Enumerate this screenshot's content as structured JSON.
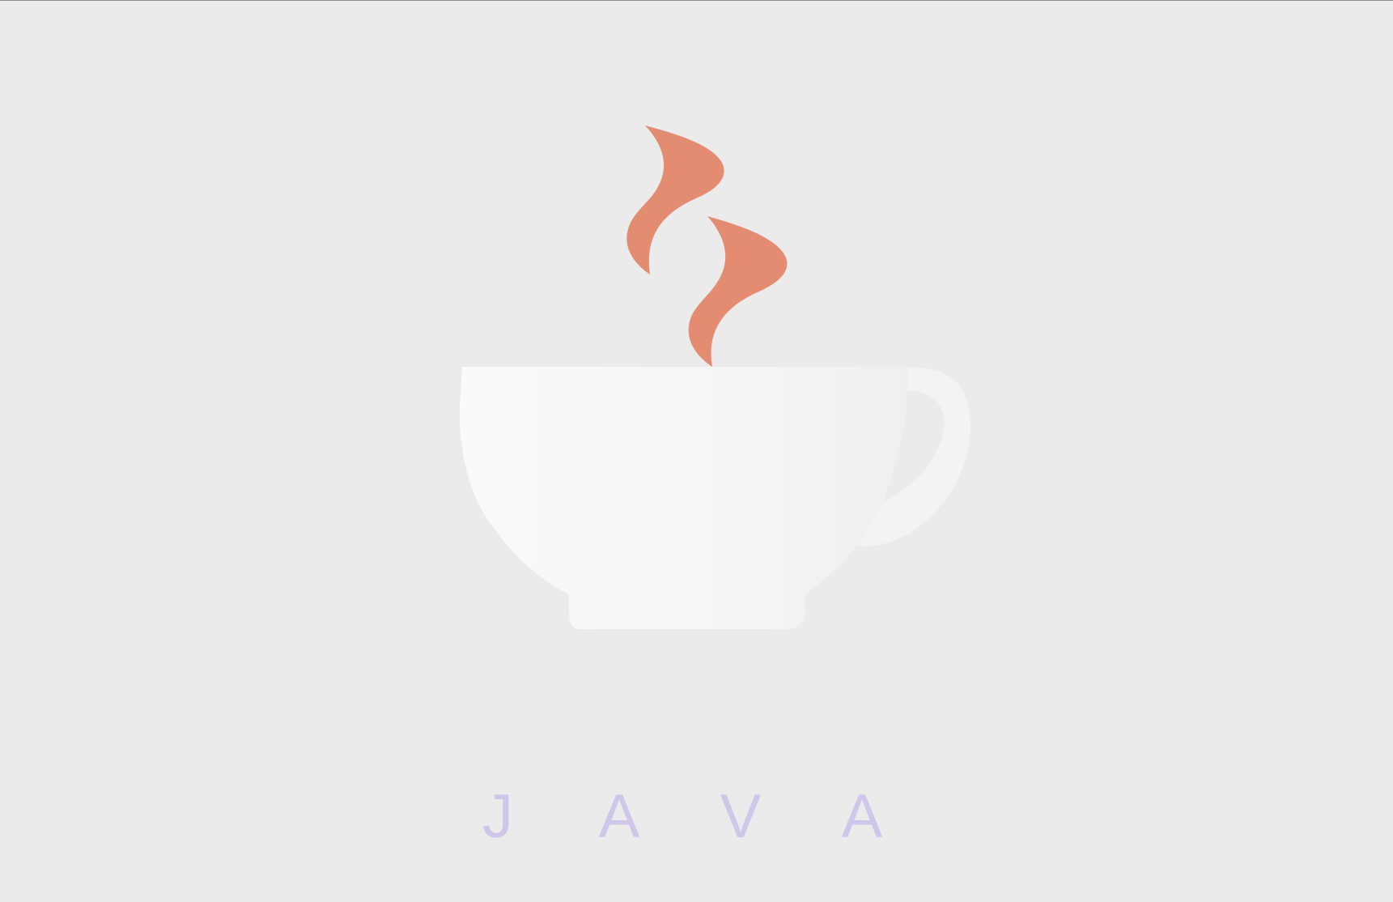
{
  "logo": {
    "name": "java-coffee-cup-logo",
    "icon": "coffee-cup-with-steam-icon",
    "colors": {
      "background": "#ebebeb",
      "steam": "#e48c72",
      "cup": "#f7f7f7",
      "wordmark": "#cfc6ea"
    }
  },
  "wordmark": {
    "letters": [
      "J",
      "A",
      "V",
      "A"
    ]
  }
}
